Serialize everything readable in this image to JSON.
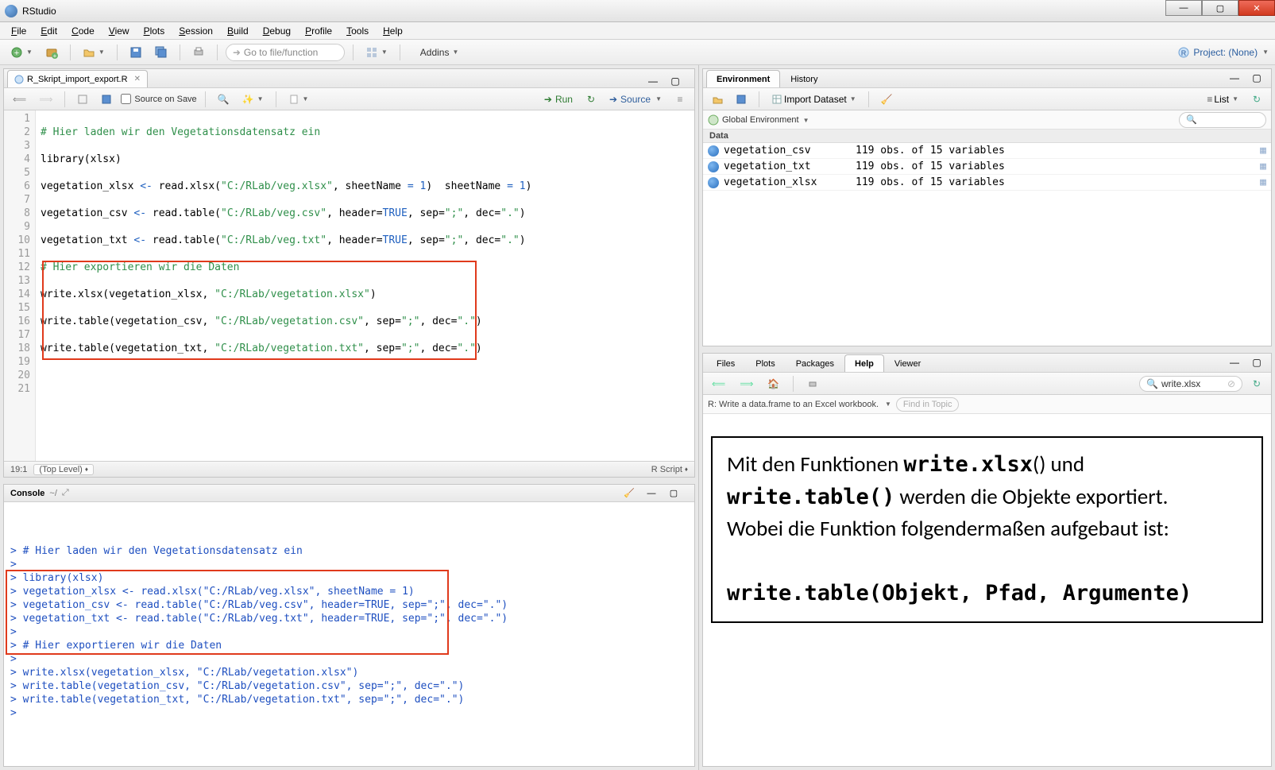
{
  "window": {
    "title": "RStudio"
  },
  "menu": [
    "File",
    "Edit",
    "Code",
    "View",
    "Plots",
    "Session",
    "Build",
    "Debug",
    "Profile",
    "Tools",
    "Help"
  ],
  "toolbar": {
    "goto_placeholder": "Go to file/function",
    "addins": "Addins",
    "project": "Project: (None)"
  },
  "source": {
    "tab": "R_Skript_import_export.R",
    "source_on_save": "Source on Save",
    "run": "Run",
    "source_btn": "Source",
    "status_pos": "19:1",
    "status_scope": "(Top Level)",
    "status_lang": "R Script",
    "lines": [
      {
        "n": 1,
        "html": ""
      },
      {
        "n": 2,
        "html": "<span class='tok-comment'># Hier laden wir den Vegetationsdatensatz ein</span>"
      },
      {
        "n": 3,
        "html": ""
      },
      {
        "n": 4,
        "html": "<span class='tok-id'>library</span>(<span class='tok-id'>xlsx</span>)"
      },
      {
        "n": 5,
        "html": ""
      },
      {
        "n": 6,
        "html": "<span class='tok-id'>vegetation_xlsx</span> <span class='tok-kw'>&lt;-</span> <span class='tok-id'>read.xlsx</span>(<span class='tok-string'>\"C:/RLab/veg.xlsx\"</span>, <span class='tok-id'>sheetName</span> <span class='tok-kw'>=</span> <span class='tok-const'>1</span>)  <span class='tok-id'>sheetName</span> <span class='tok-kw'>=</span> <span class='tok-const'>1</span>)"
      },
      {
        "n": 7,
        "html": ""
      },
      {
        "n": 8,
        "html": "<span class='tok-id'>vegetation_csv</span> <span class='tok-kw'>&lt;-</span> <span class='tok-id'>read.table</span>(<span class='tok-string'>\"C:/RLab/veg.csv\"</span>, <span class='tok-id'>header</span>=<span class='tok-const'>TRUE</span>, <span class='tok-id'>sep</span>=<span class='tok-string'>\";\"</span>, <span class='tok-id'>dec</span>=<span class='tok-string'>\".\"</span>)"
      },
      {
        "n": 9,
        "html": ""
      },
      {
        "n": 10,
        "html": "<span class='tok-id'>vegetation_txt</span> <span class='tok-kw'>&lt;-</span> <span class='tok-id'>read.table</span>(<span class='tok-string'>\"C:/RLab/veg.txt\"</span>, <span class='tok-id'>header</span>=<span class='tok-const'>TRUE</span>, <span class='tok-id'>sep</span>=<span class='tok-string'>\";\"</span>, <span class='tok-id'>dec</span>=<span class='tok-string'>\".\"</span>)"
      },
      {
        "n": 11,
        "html": ""
      },
      {
        "n": 12,
        "html": "<span class='tok-comment'># Hier exportieren wir die Daten</span>"
      },
      {
        "n": 13,
        "html": ""
      },
      {
        "n": 14,
        "html": "<span class='tok-id'>write.xlsx</span>(<span class='tok-id'>vegetation_xlsx</span>, <span class='tok-string'>\"C:/RLab/vegetation.xlsx\"</span>)"
      },
      {
        "n": 15,
        "html": ""
      },
      {
        "n": 16,
        "html": "<span class='tok-id'>write.table</span>(<span class='tok-id'>vegetation_csv</span>, <span class='tok-string'>\"C:/RLab/vegetation.csv\"</span>, <span class='tok-id'>sep</span>=<span class='tok-string'>\";\"</span>, <span class='tok-id'>dec</span>=<span class='tok-string'>\".\"</span>)"
      },
      {
        "n": 17,
        "html": ""
      },
      {
        "n": 18,
        "html": "<span class='tok-id'>write.table</span>(<span class='tok-id'>vegetation_txt</span>, <span class='tok-string'>\"C:/RLab/vegetation.txt\"</span>, <span class='tok-id'>sep</span>=<span class='tok-string'>\";\"</span>, <span class='tok-id'>dec</span>=<span class='tok-string'>\".\"</span>)"
      },
      {
        "n": 19,
        "html": ""
      },
      {
        "n": 20,
        "html": ""
      },
      {
        "n": 21,
        "html": ""
      }
    ]
  },
  "console": {
    "title": "Console",
    "path": "~/",
    "lines": [
      "> # Hier laden wir den Vegetationsdatensatz ein",
      "> ",
      "> library(xlsx)",
      "> vegetation_xlsx <- read.xlsx(\"C:/RLab/veg.xlsx\", sheetName = 1)",
      "> vegetation_csv <- read.table(\"C:/RLab/veg.csv\", header=TRUE, sep=\";\", dec=\".\")",
      "> vegetation_txt <- read.table(\"C:/RLab/veg.txt\", header=TRUE, sep=\";\", dec=\".\")",
      "> ",
      "> # Hier exportieren wir die Daten",
      "> ",
      "> write.xlsx(vegetation_xlsx, \"C:/RLab/vegetation.xlsx\")",
      "> write.table(vegetation_csv, \"C:/RLab/vegetation.csv\", sep=\";\", dec=\".\")",
      "> write.table(vegetation_txt, \"C:/RLab/vegetation.txt\", sep=\";\", dec=\".\")",
      "> "
    ]
  },
  "env": {
    "tabs": [
      "Environment",
      "History"
    ],
    "import": "Import Dataset",
    "scope": "Global Environment",
    "list": "List",
    "data_header": "Data",
    "rows": [
      {
        "name": "vegetation_csv",
        "desc": "119 obs. of 15 variables"
      },
      {
        "name": "vegetation_txt",
        "desc": "119 obs. of 15 variables"
      },
      {
        "name": "vegetation_xlsx",
        "desc": "119 obs. of 15 variables"
      }
    ]
  },
  "help": {
    "tabs": [
      "Files",
      "Plots",
      "Packages",
      "Help",
      "Viewer"
    ],
    "search_value": "write.xlsx",
    "breadcrumb": "R: Write a data.frame to an Excel workbook.",
    "find_placeholder": "Find in Topic",
    "body_html": "Mit den Funktionen  <span class='mono'>write.xlsx</span>() und <span class='mono'>write.table()</span> werden die Objekte exportiert.<br>Wobei die Funktion folgendermaßen aufgebaut ist:<br><br><span class='mono'>write.table(Objekt, Pfad, Argumente)</span>"
  }
}
